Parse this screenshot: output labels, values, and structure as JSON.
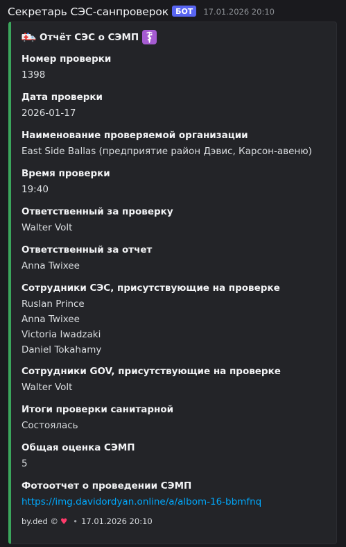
{
  "header": {
    "author": "Секретарь СЭС-санпроверок",
    "bot_tag": "БОТ",
    "timestamp": "17.01.2026 20:10"
  },
  "embed": {
    "accent_color": "#3ba55c",
    "title_icon_left": "ambulance-icon",
    "title": "Отчёт СЭС о СЭМП",
    "title_icon_right": "medical-symbol-icon",
    "fields": [
      {
        "name": "Номер проверки",
        "values": [
          "1398"
        ]
      },
      {
        "name": "Дата проверки",
        "values": [
          "2026-01-17"
        ]
      },
      {
        "name": "Наименование проверяемой организации",
        "values": [
          "East Side Ballas (предприятие район Дэвис, Карсон-авеню)"
        ]
      },
      {
        "name": "Время проверки",
        "values": [
          "19:40"
        ]
      },
      {
        "name": "Ответственный за проверку",
        "values": [
          "Walter Volt"
        ]
      },
      {
        "name": "Ответственный за отчет",
        "values": [
          "Anna Twixee"
        ]
      },
      {
        "name": "Сотрудники СЭС, присутствующие на проверке",
        "values": [
          "Ruslan Prince",
          "Anna Twixee",
          "Victoria Iwadzaki",
          "Daniel Tokahamy"
        ]
      },
      {
        "name": "Сотрудники GOV, присутствующие на проверке",
        "values": [
          "Walter Volt"
        ]
      },
      {
        "name": "Итоги проверки санитарной",
        "values": [
          "Состоялась"
        ]
      },
      {
        "name": "Общая оценка СЭМП",
        "values": [
          "5"
        ]
      },
      {
        "name": "Фотоотчет о проведении СЭМП",
        "values": [
          "https://img.davidordyan.online/a/albom-16-bbmfnq"
        ]
      }
    ],
    "footer": {
      "text": "by.ded ©",
      "icon": "heart-icon",
      "separator": "•",
      "timestamp": "17.01.2026 20:10"
    }
  }
}
